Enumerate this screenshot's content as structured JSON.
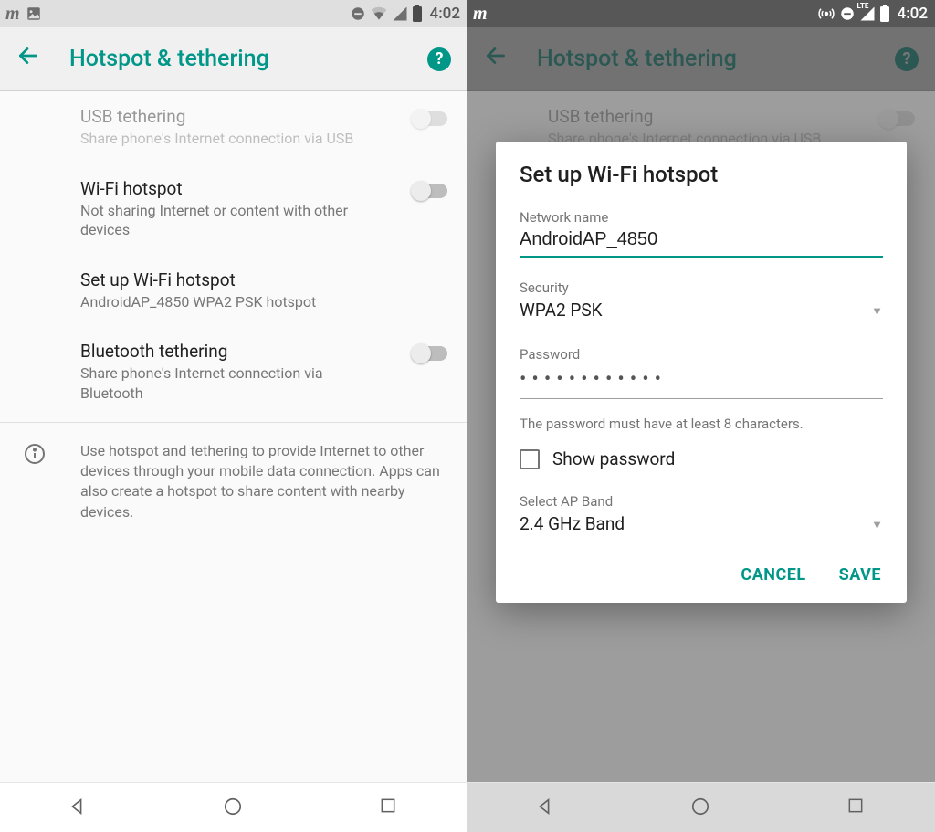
{
  "status": {
    "time": "4:02",
    "lte": "LTE"
  },
  "appbar": {
    "title": "Hotspot & tethering"
  },
  "items": {
    "usb": {
      "title": "USB tethering",
      "sub": "Share phone's Internet connection via USB"
    },
    "wifi": {
      "title": "Wi-Fi hotspot",
      "sub": "Not sharing Internet or content with other devices"
    },
    "setup": {
      "title": "Set up Wi-Fi hotspot",
      "sub": "AndroidAP_4850 WPA2 PSK hotspot"
    },
    "bt": {
      "title": "Bluetooth tethering",
      "sub": "Share phone's Internet connection via Bluetooth"
    }
  },
  "info": "Use hotspot and tethering to provide Internet to other devices through your mobile data connection. Apps can also create a hotspot to share content with nearby devices.",
  "dialog": {
    "title": "Set up Wi-Fi hotspot",
    "network_label": "Network name",
    "network_value": "AndroidAP_4850",
    "security_label": "Security",
    "security_value": "WPA2 PSK",
    "password_label": "Password",
    "password_mask": "••••••••••••",
    "password_hint": "The password must have at least 8 characters.",
    "show_password": "Show password",
    "band_label": "Select AP Band",
    "band_value": "2.4 GHz Band",
    "cancel": "CANCEL",
    "save": "SAVE"
  }
}
